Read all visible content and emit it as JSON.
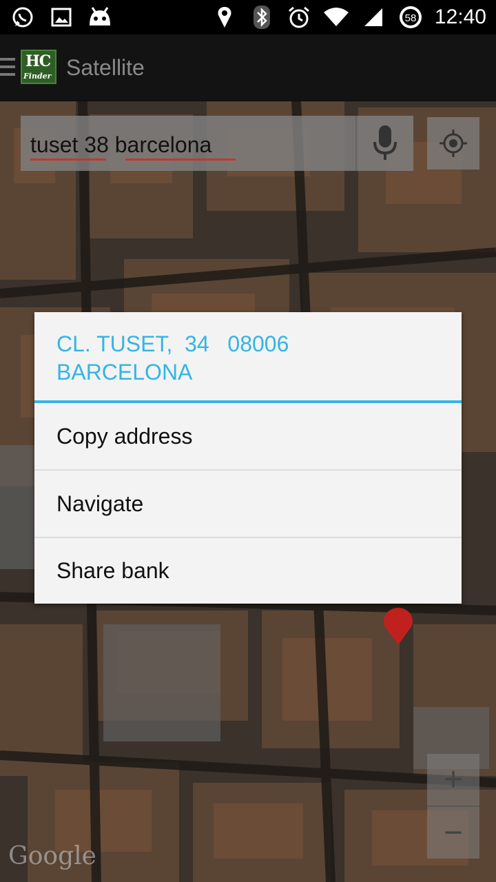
{
  "status_bar": {
    "time": "12:40",
    "battery_level": "58",
    "icons": [
      "whatsapp-icon",
      "image-icon",
      "android-icon",
      "location-icon",
      "bluetooth-icon",
      "alarm-icon",
      "wifi-icon",
      "signal-icon",
      "battery-icon"
    ]
  },
  "action_bar": {
    "logo_main": "HC",
    "logo_sub": "Finder",
    "title": "Satellite"
  },
  "search": {
    "value": "tuset 38 barcelona"
  },
  "map": {
    "zoom_in": "+",
    "zoom_out": "−",
    "attribution": "Google"
  },
  "dialog": {
    "title": "CL. TUSET,  34   08006\nBARCELONA",
    "items": [
      {
        "label": "Copy address"
      },
      {
        "label": "Navigate"
      },
      {
        "label": "Share bank"
      }
    ],
    "accent_color": "#33b5e5"
  }
}
